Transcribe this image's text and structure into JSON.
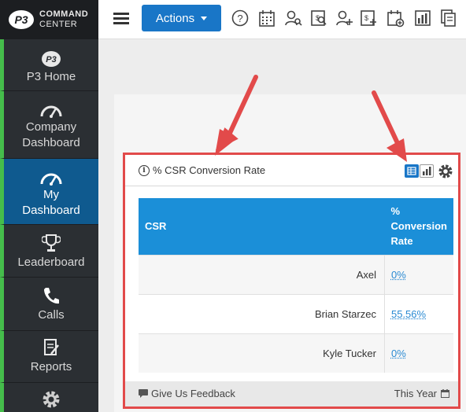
{
  "app": {
    "logo_text_line1": "COMMAND",
    "logo_text_line2": "CENTER",
    "logo_mark": "P3"
  },
  "sidebar": {
    "items": [
      {
        "label": "P3 Home",
        "icon": "p3-logo-icon"
      },
      {
        "label": "Company Dashboard",
        "icon": "gauge-icon"
      },
      {
        "label": "My Dashboard",
        "icon": "gauge-icon",
        "active": true
      },
      {
        "label": "Leaderboard",
        "icon": "trophy-icon"
      },
      {
        "label": "Calls",
        "icon": "phone-icon"
      },
      {
        "label": "Reports",
        "icon": "report-icon"
      },
      {
        "label": "",
        "icon": "gear-icon"
      }
    ],
    "accent_color": "#45bd4b",
    "active_color": "#0f5a8f"
  },
  "toolbar": {
    "actions_label": "Actions",
    "icons": [
      "help-icon",
      "calendar-grid-icon",
      "user-search-icon",
      "search-dollar-icon",
      "add-user-icon",
      "add-invoice-icon",
      "add-calendar-icon",
      "bar-chart-icon",
      "documents-icon"
    ]
  },
  "widget": {
    "title": "% CSR Conversion Rate",
    "columns": [
      "CSR",
      "% Conversion Rate"
    ],
    "rows": [
      {
        "csr": "Axel",
        "rate": "0%"
      },
      {
        "csr": "Brian Starzec",
        "rate": "55.56%"
      },
      {
        "csr": "Kyle Tucker",
        "rate": "0%"
      }
    ],
    "feedback_label": "Give Us Feedback",
    "period_label": "This Year",
    "header_color": "#1b8fd8",
    "highlight_color": "#e24a4a"
  }
}
